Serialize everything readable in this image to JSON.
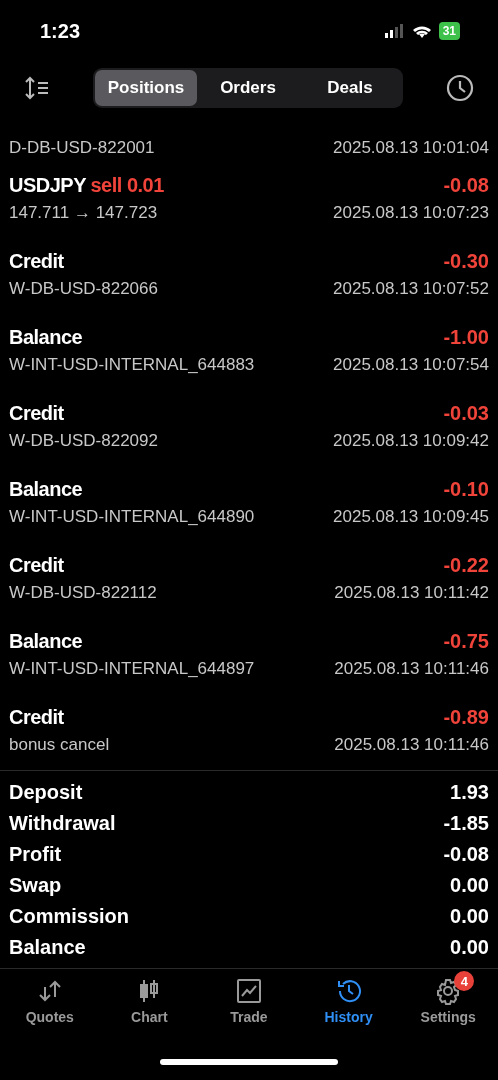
{
  "status_bar": {
    "time": "1:23",
    "battery": "31"
  },
  "segments": [
    {
      "label": "Positions",
      "selected": true
    },
    {
      "label": "Orders",
      "selected": false
    },
    {
      "label": "Deals",
      "selected": false
    }
  ],
  "partial_row": {
    "subtitle": "D-DB-USD-822001",
    "date": "2025.08.13 10:01:04"
  },
  "rows": [
    {
      "title": "USDJPY",
      "action": "sell 0.01",
      "subtitle": "147.711 → 147.723",
      "amount": "-0.08",
      "date": "2025.08.13 10:07:23"
    },
    {
      "title": "Credit",
      "subtitle": "W-DB-USD-822066",
      "amount": "-0.30",
      "date": "2025.08.13 10:07:52"
    },
    {
      "title": "Balance",
      "subtitle": "W-INT-USD-INTERNAL_644883",
      "amount": "-1.00",
      "date": "2025.08.13 10:07:54"
    },
    {
      "title": "Credit",
      "subtitle": "W-DB-USD-822092",
      "amount": "-0.03",
      "date": "2025.08.13 10:09:42"
    },
    {
      "title": "Balance",
      "subtitle": "W-INT-USD-INTERNAL_644890",
      "amount": "-0.10",
      "date": "2025.08.13 10:09:45"
    },
    {
      "title": "Credit",
      "subtitle": "W-DB-USD-822112",
      "amount": "-0.22",
      "date": "2025.08.13 10:11:42"
    },
    {
      "title": "Balance",
      "subtitle": "W-INT-USD-INTERNAL_644897",
      "amount": "-0.75",
      "date": "2025.08.13 10:11:46"
    },
    {
      "title": "Credit",
      "subtitle": "bonus cancel",
      "amount": "-0.89",
      "date": "2025.08.13 10:11:46"
    }
  ],
  "summary": [
    {
      "label": "Deposit",
      "value": "1.93"
    },
    {
      "label": "Withdrawal",
      "value": "-1.85"
    },
    {
      "label": "Profit",
      "value": "-0.08"
    },
    {
      "label": "Swap",
      "value": "0.00"
    },
    {
      "label": "Commission",
      "value": "0.00"
    },
    {
      "label": "Balance",
      "value": "0.00"
    }
  ],
  "tab_bar": [
    {
      "label": "Quotes",
      "kind": "quotes",
      "selected": false
    },
    {
      "label": "Chart",
      "kind": "chart",
      "selected": false
    },
    {
      "label": "Trade",
      "kind": "trade",
      "selected": false
    },
    {
      "label": "History",
      "kind": "history",
      "selected": true
    },
    {
      "label": "Settings",
      "kind": "settings",
      "selected": false,
      "badge": "4"
    }
  ]
}
